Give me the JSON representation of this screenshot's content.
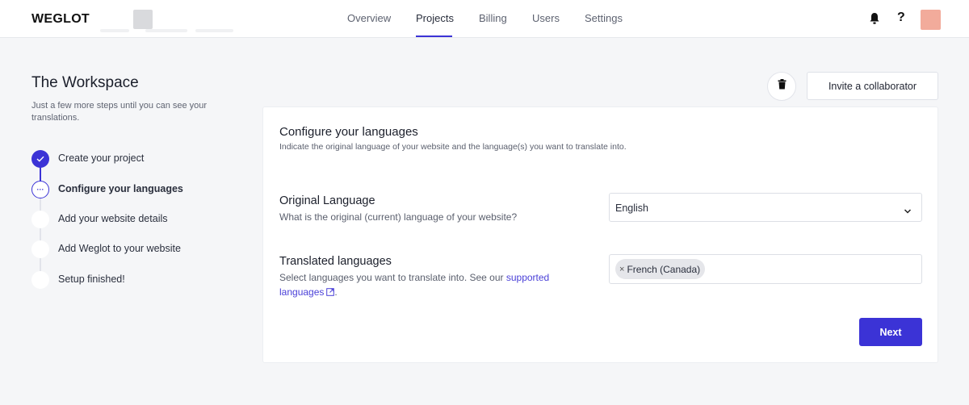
{
  "brand": {
    "logo_text": "WEGLOT",
    "accent_color": "#3b33d6",
    "avatar_color": "#f2ab9b"
  },
  "nav": {
    "items": [
      {
        "label": "Overview"
      },
      {
        "label": "Projects",
        "active": true
      },
      {
        "label": "Billing"
      },
      {
        "label": "Users"
      },
      {
        "label": "Settings"
      }
    ],
    "help_label": "?"
  },
  "sidebar": {
    "title": "The Workspace",
    "subtitle": "Just a few more steps until you can see your translations.",
    "steps": [
      {
        "label": "Create your project",
        "status": "done",
        "icon": "check-icon"
      },
      {
        "label": "Configure your languages",
        "status": "current",
        "icon": "ellipsis-icon",
        "marker": "···"
      },
      {
        "label": "Add your website details",
        "status": "pending"
      },
      {
        "label": "Add Weglot to your website",
        "status": "pending"
      },
      {
        "label": "Setup finished!",
        "status": "pending"
      }
    ]
  },
  "actions": {
    "invite_label": "Invite a collaborator",
    "delete_icon": "trash-icon"
  },
  "card": {
    "title": "Configure your languages",
    "subtitle": "Indicate the original language of your website and the language(s) you want to translate into.",
    "original": {
      "title": "Original Language",
      "description": "What is the original (current) language of your website?",
      "value": "English"
    },
    "translated": {
      "title": "Translated languages",
      "description_prefix": "Select languages you want to translate into. See our ",
      "link_text_1": "supported",
      "link_text_2": "languages",
      "description_suffix": ".",
      "chips": [
        {
          "label": "French (Canada)",
          "remove": "×"
        }
      ]
    },
    "next_label": "Next"
  }
}
